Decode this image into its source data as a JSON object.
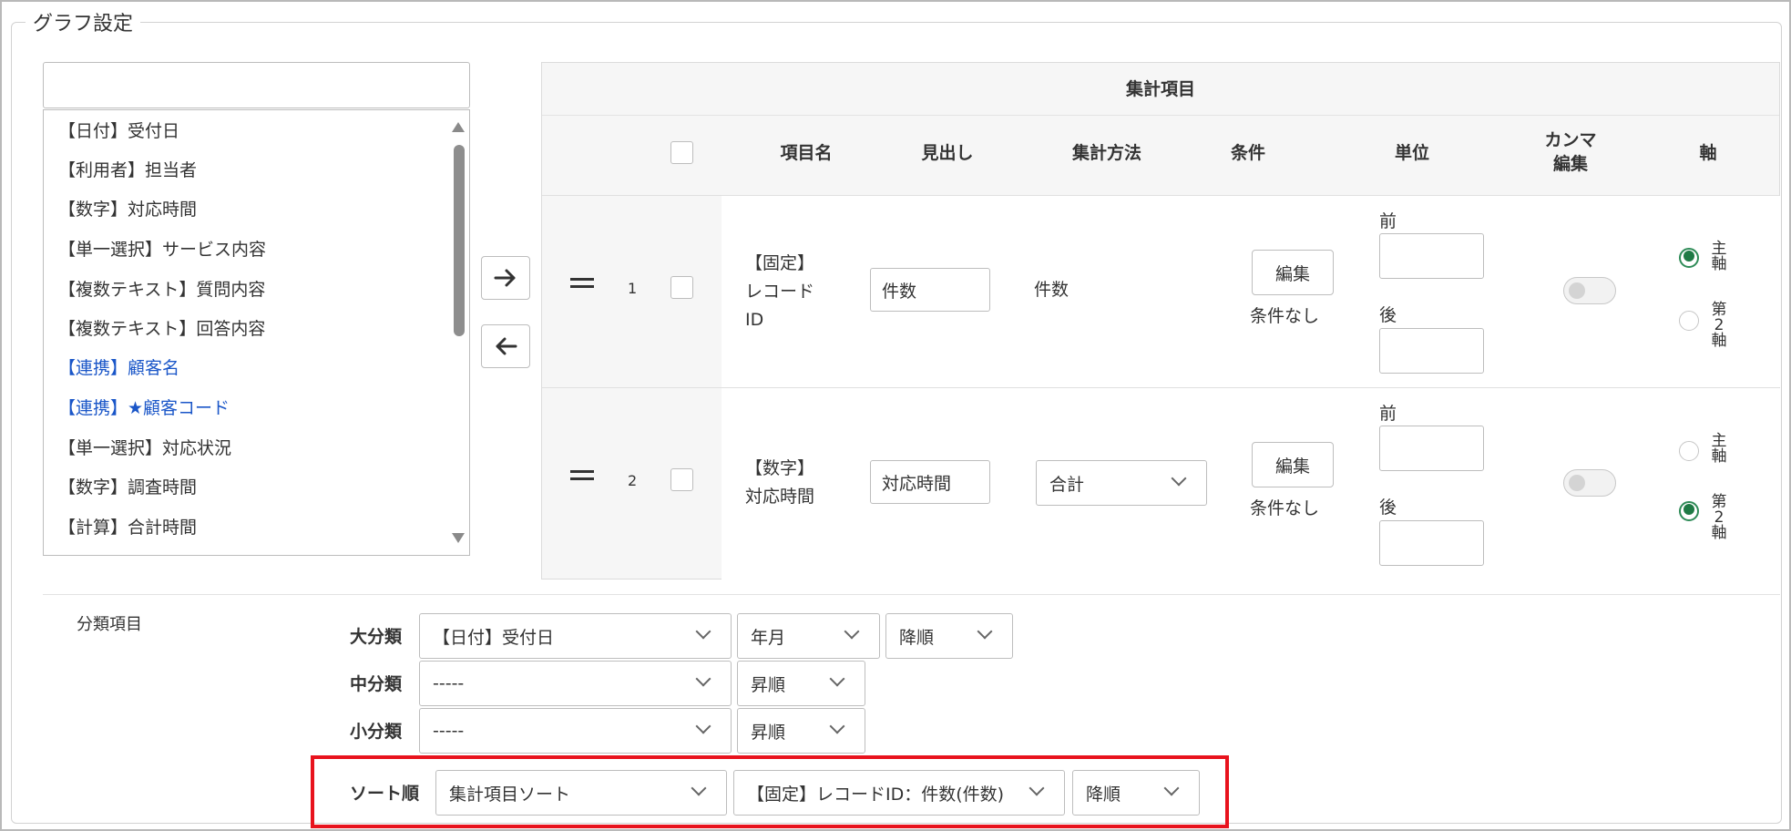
{
  "legend": "グラフ設定",
  "field_list": {
    "search_placeholder": "",
    "items": [
      {
        "label": "【日付】受付日",
        "linked": false
      },
      {
        "label": "【利用者】担当者",
        "linked": false
      },
      {
        "label": "【数字】対応時間",
        "linked": false
      },
      {
        "label": "【単一選択】サービス内容",
        "linked": false
      },
      {
        "label": "【複数テキスト】質問内容",
        "linked": false
      },
      {
        "label": "【複数テキスト】回答内容",
        "linked": false
      },
      {
        "label": "【連携】顧客名",
        "linked": true
      },
      {
        "label": "【連携】★顧客コード",
        "linked": true
      },
      {
        "label": "【単一選択】対応状況",
        "linked": false
      },
      {
        "label": "【数字】調査時間",
        "linked": false
      },
      {
        "label": "【計算】合計時間",
        "linked": false
      }
    ]
  },
  "move_buttons": {
    "add_icon": "arrow-right-icon",
    "remove_icon": "arrow-left-icon"
  },
  "agg_table": {
    "title": "集計項目",
    "headers": {
      "name": "項目名",
      "heading": "見出し",
      "method": "集計方法",
      "condition": "条件",
      "unit": "単位",
      "comma": "カンマ編集",
      "axis": "軸"
    },
    "unit_labels": {
      "before": "前",
      "after": "後"
    },
    "axis_labels": {
      "primary": "主軸",
      "secondary": "第2軸"
    },
    "rows": [
      {
        "num": "1",
        "item_line1": "【固定】",
        "item_line2": "レコード",
        "item_line3": "ID",
        "heading": "件数",
        "method": "件数",
        "edit": "編集",
        "condition": "条件なし",
        "unit_before": "",
        "unit_after": "",
        "axis": "primary"
      },
      {
        "num": "2",
        "item_line1": "【数字】",
        "item_line2": "対応時間",
        "item_line3": "",
        "heading": "対応時間",
        "method": "合計",
        "edit": "編集",
        "condition": "条件なし",
        "unit_before": "",
        "unit_after": "",
        "axis": "secondary"
      }
    ]
  },
  "classification": {
    "section_label": "分類項目",
    "large": {
      "label": "大分類",
      "field": "【日付】受付日",
      "period": "年月",
      "order": "降順"
    },
    "medium": {
      "label": "中分類",
      "field": "-----",
      "order": "昇順"
    },
    "small": {
      "label": "小分類",
      "field": "-----",
      "order": "昇順"
    },
    "sort": {
      "label": "ソート順",
      "type": "集計項目ソート",
      "target": "【固定】レコードID：件数(件数)",
      "order": "降順"
    }
  },
  "colors": {
    "highlight": "#e8131d",
    "radio_on": "#1f7a45",
    "link": "#1a56c8"
  }
}
